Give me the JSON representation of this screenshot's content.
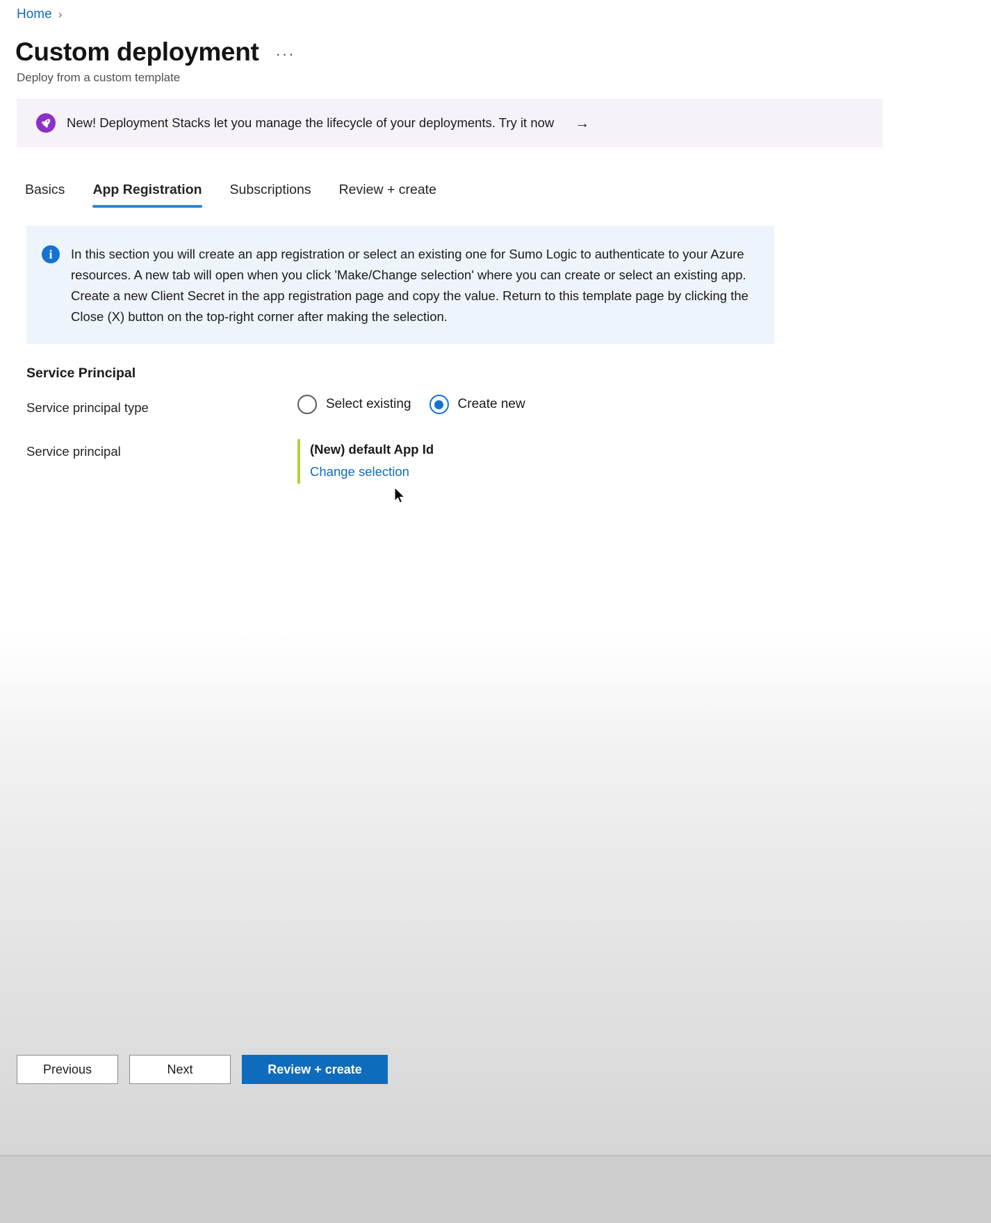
{
  "breadcrumb": {
    "home": "Home",
    "separator": "›"
  },
  "header": {
    "title": "Custom deployment",
    "overflow": "···",
    "subtitle": "Deploy from a custom template"
  },
  "banner": {
    "icon": "rocket-icon",
    "text": "New! Deployment Stacks let you manage the lifecycle of your deployments. Try it now",
    "arrow": "→",
    "background": "#f7f2f9",
    "icon_color": "#8b2fc9"
  },
  "tabs": [
    {
      "label": "Basics",
      "active": false
    },
    {
      "label": "App Registration",
      "active": true
    },
    {
      "label": "Subscriptions",
      "active": false
    },
    {
      "label": "Review + create",
      "active": false
    }
  ],
  "info_box": {
    "icon": "info-icon",
    "icon_glyph": "i",
    "background": "#eef4fb",
    "accent": "#1472d4",
    "text": "In this section you will create an app registration or select an existing one for Sumo Logic to authenticate to your Azure resources. A new tab will open when you click 'Make/Change selection' where you can create or select an existing app. Create a new Client Secret in the app registration page and copy the value. Return to this template page by clicking the Close (X) button on the top-right corner after making the selection."
  },
  "form": {
    "section_heading": "Service Principal",
    "service_principal_type": {
      "label": "Service principal type",
      "options": [
        {
          "label": "Select existing",
          "selected": false
        },
        {
          "label": "Create new",
          "selected": true
        }
      ]
    },
    "service_principal": {
      "label": "Service principal",
      "value": "(New) default App Id",
      "change_link": "Change selection",
      "accent_color": "#b9cc3a",
      "link_color": "#0f6cbd"
    }
  },
  "footer": {
    "previous": "Previous",
    "next": "Next",
    "review_create": "Review + create",
    "primary_color": "#0f6cbd"
  }
}
